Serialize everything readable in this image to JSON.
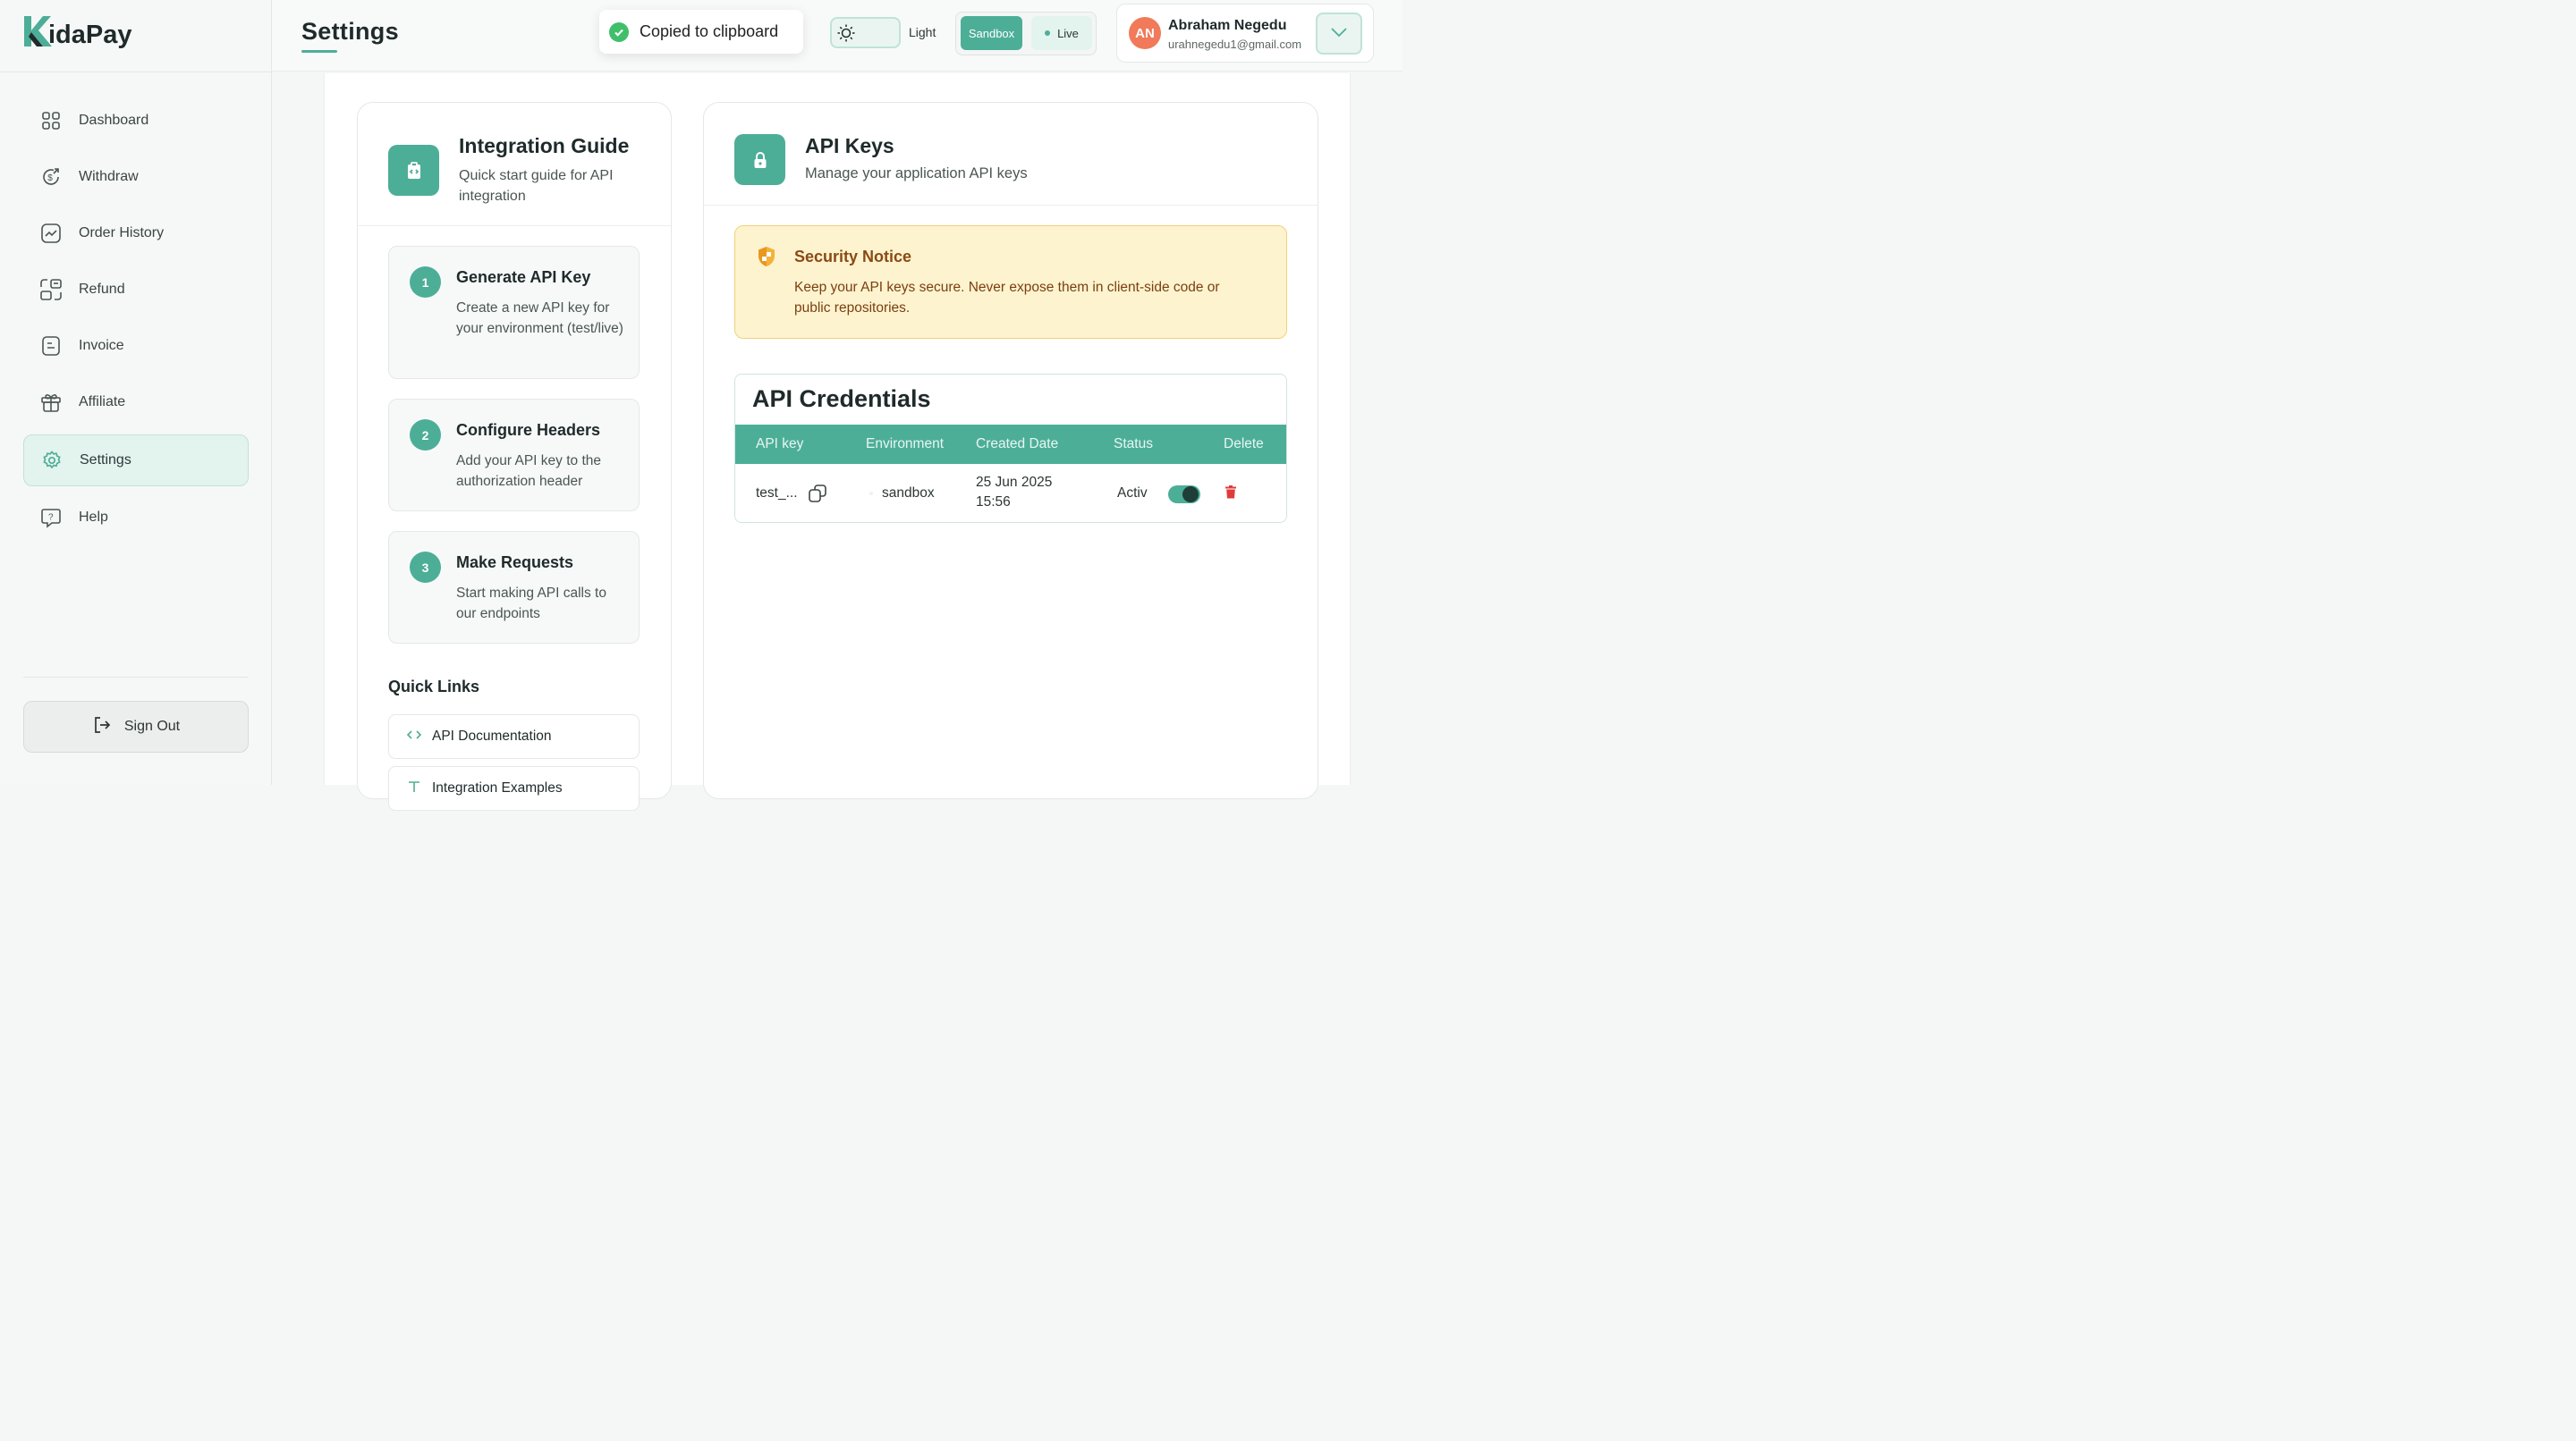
{
  "brand": {
    "logo_k": "K",
    "logo_rest": "idaPay",
    "accent": "#4dae98"
  },
  "sidebar": {
    "items": [
      {
        "label": "Dashboard",
        "icon": "grid-icon"
      },
      {
        "label": "Withdraw",
        "icon": "dollar-cycle-icon"
      },
      {
        "label": "Order History",
        "icon": "chart-line-icon"
      },
      {
        "label": "Refund",
        "icon": "refund-icon"
      },
      {
        "label": "Invoice",
        "icon": "invoice-icon"
      },
      {
        "label": "Affiliate",
        "icon": "gift-icon"
      },
      {
        "label": "Settings",
        "icon": "gear-icon",
        "active": true
      },
      {
        "label": "Help",
        "icon": "help-bubble-icon"
      }
    ],
    "sign_out": "Sign Out"
  },
  "header": {
    "title": "Settings",
    "toast": "Copied to clipboard",
    "theme_label": "Light",
    "env_sandbox": "Sandbox",
    "env_live": "Live",
    "user": {
      "initials": "AN",
      "name": "Abraham Negedu",
      "email": "urahnegedu1@gmail.com"
    }
  },
  "guide": {
    "title": "Integration Guide",
    "subtitle": "Quick start guide for API integration",
    "steps": [
      {
        "num": "1",
        "title": "Generate API Key",
        "desc": "Create a new API key for your environment (test/live)"
      },
      {
        "num": "2",
        "title": "Configure Headers",
        "desc": "Add your API key to the authorization header"
      },
      {
        "num": "3",
        "title": "Make Requests",
        "desc": "Start making API calls to our endpoints"
      }
    ],
    "quick_links_title": "Quick Links",
    "quick_links": [
      "API Documentation",
      "Integration Examples"
    ]
  },
  "api_keys": {
    "title": "API Keys",
    "subtitle": "Manage your application API keys",
    "notice": {
      "title": "Security Notice",
      "text": "Keep your API keys secure. Never expose them in client-side code or public repositories."
    },
    "credentials": {
      "title": "API Credentials",
      "columns": [
        "API key",
        "Environment",
        "Created Date",
        "Status",
        "Delete"
      ],
      "rows": [
        {
          "key": "test_...",
          "environment": "sandbox",
          "created": "25 Jun 2025",
          "created_time": "15:56",
          "status": "Activ",
          "enabled": true
        }
      ]
    }
  }
}
